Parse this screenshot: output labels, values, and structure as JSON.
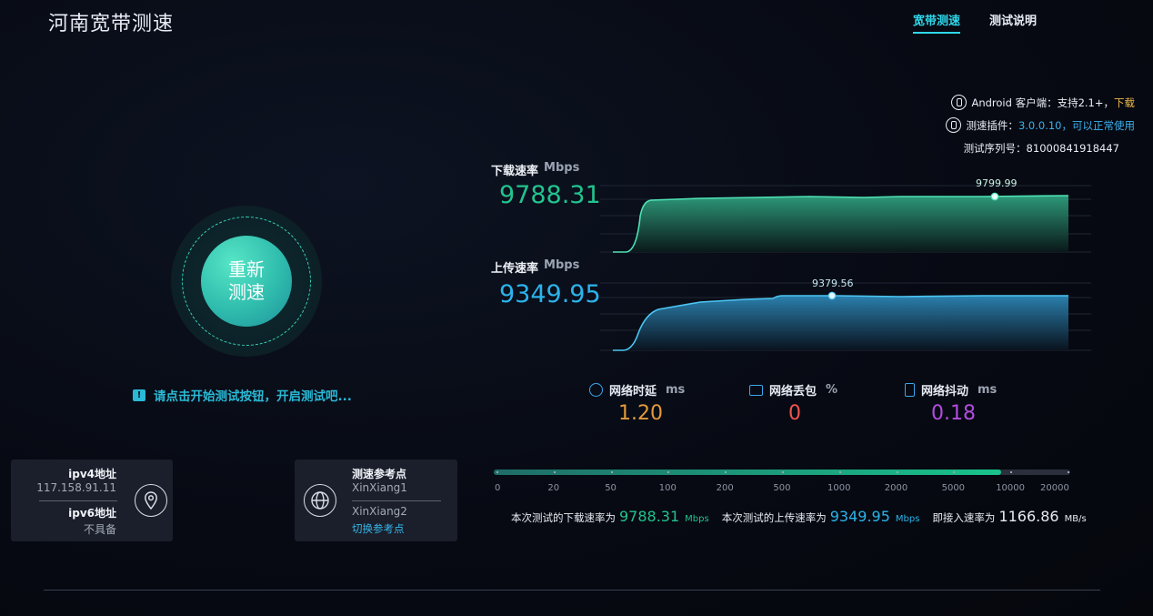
{
  "header": {
    "title": "河南宽带测速",
    "nav": [
      "宽带测速",
      "测试说明"
    ]
  },
  "info": {
    "android_label": "Android 客户端：支持2.1+，",
    "android_link": "下载",
    "plugin_label": "测速插件：",
    "plugin_value": "3.0.0.10，可以正常使用",
    "serial": "测试序列号：81000841918447"
  },
  "start_button": {
    "line1": "重新",
    "line2": "测速"
  },
  "hint": "请点击开始测试按钮，开启测试吧...",
  "ip_card": {
    "ipv4_label": "ipv4地址",
    "ipv4_value": "117.158.91.11",
    "ipv6_label": "ipv6地址",
    "ipv6_value": "不具备"
  },
  "ref_card": {
    "label": "测速参考点",
    "point1": "XinXiang1",
    "point2": "XinXiang2",
    "switch": "切换参考点"
  },
  "download": {
    "label": "下载速率",
    "unit": "Mbps",
    "value": "9788.31",
    "peak": "9799.99",
    "color": "#22c38e"
  },
  "upload": {
    "label": "上传速率",
    "unit": "Mbps",
    "value": "9349.95",
    "peak": "9379.56",
    "color": "#2cb3ea"
  },
  "stats": [
    {
      "label": "网络时延",
      "unit": "ms",
      "value": "1.20",
      "color": "#e29a3c"
    },
    {
      "label": "网络丢包",
      "unit": "%",
      "value": "0",
      "color": "#f0544f"
    },
    {
      "label": "网络抖动",
      "unit": "ms",
      "value": "0.18",
      "color": "#b24ce0"
    }
  ],
  "scale": {
    "ticks": [
      "0",
      "20",
      "50",
      "100",
      "200",
      "500",
      "1000",
      "2000",
      "5000",
      "10000",
      "20000"
    ],
    "level_fraction": 0.88
  },
  "summary": {
    "dl_text": "本次测试的下载速率为",
    "dl_value": "9788.31",
    "dl_unit": "Mbps",
    "ul_text": "本次测试的上传速率为",
    "ul_value": "9349.95",
    "ul_unit": "Mbps",
    "access_text": "即接入速率为",
    "access_value": "1166.86",
    "access_unit": "MB/s"
  }
}
